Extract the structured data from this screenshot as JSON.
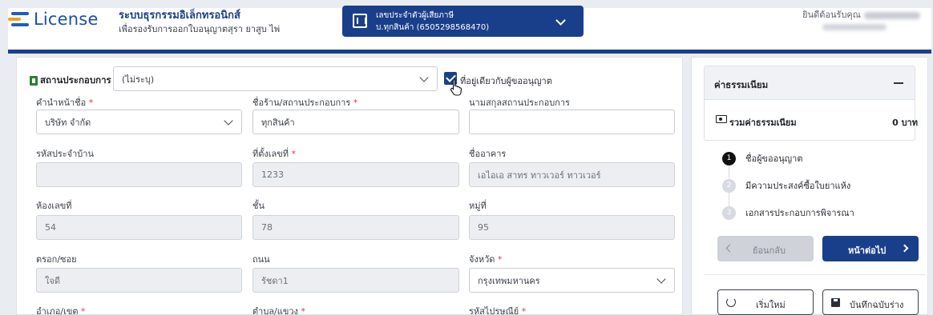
{
  "header": {
    "logo_text": "License",
    "system_title": "ระบบธุรกรรมอิเล็กทรอนิกส์",
    "system_subtitle": "เพื่อรองรับการออกใบอนุญาตสุรา ยาสูบ ไพ่",
    "taxpayer_line1": "เลขประจำตัวผู้เสียภาษี",
    "taxpayer_line2": "บ.ทุกสินค้า (6505298568470)",
    "welcome": "ยินดีต้อนรับคุณ"
  },
  "establishment": {
    "label": "สถานประกอบการ",
    "value": "(ไม่ระบุ)",
    "same_address_label": "ที่อยู่เดียวกับผู้ขออนุญาต",
    "same_address_checked": true
  },
  "form": {
    "prefix_label": "คำนำหน้าชื่อ",
    "prefix_value": "บริษัท จำกัด",
    "shop_name_label": "ชื่อร้าน/สถานประกอบการ",
    "shop_name_value": "ทุกสินค้า",
    "shop_surname_label": "นามสกุลสถานประกอบการ",
    "shop_surname_value": "",
    "house_code_label": "รหัสประจำบ้าน",
    "house_code_value": "",
    "address_no_label": "ที่ตั้งเลขที่",
    "address_no_value": "1233",
    "building_label": "ชื่ออาคาร",
    "building_value": "เอไอเอ สาทร ทาวเวอร์ ทาวเวอร์",
    "room_label": "ห้องเลขที่",
    "room_value": "54",
    "floor_label": "ชั้น",
    "floor_value": "78",
    "village_label": "หมู่ที่",
    "village_value": "95",
    "soi_label": "ตรอก/ซอย",
    "soi_value": "ใจดี",
    "road_label": "ถนน",
    "road_value": "รัชดา1",
    "province_label": "จังหวัด",
    "province_value": "กรุงเทพมหานคร",
    "district_label": "อำเภอ/เขต",
    "subdistrict_label": "ตำบล/แขวง",
    "postcode_label": "รหัสไปรษณีย์",
    "required_mark": "*"
  },
  "side": {
    "fee_title": "ค่าธรรมเนียม",
    "fee_total_label": "รวมค่าธรรมเนียม",
    "fee_total_value": "0 บาท",
    "steps": [
      {
        "num": "1",
        "label": "ชื่อผู้ขออนุญาต"
      },
      {
        "num": "2",
        "label": "มีความประสงค์ซื้อใบยาแห้ง"
      },
      {
        "num": "3",
        "label": "เอกสารประกอบการพิจารณา"
      }
    ],
    "back_label": "ย้อนกลับ",
    "next_label": "หน้าต่อไป",
    "reset_label": "เริ่มใหม่",
    "save_draft_label": "บันทึกฉบับร่าง"
  },
  "colors": {
    "primary": "#1a3f8a",
    "required": "#d93b3b",
    "logo_accent": "#f0a020"
  }
}
